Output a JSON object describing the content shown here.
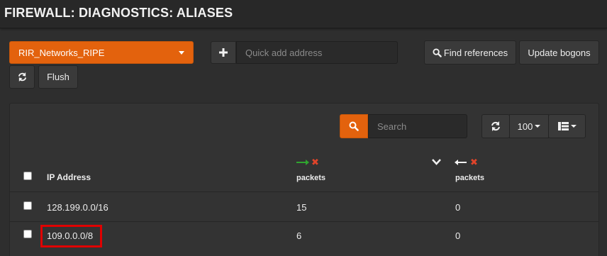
{
  "header": {
    "title": "FIREWALL: DIAGNOSTICS: ALIASES"
  },
  "toolbar": {
    "alias_selected": "RIR_Networks_RIPE",
    "quick_add_placeholder": "Quick add address",
    "find_references_label": "Find references",
    "update_bogons_label": "Update bogons",
    "flush_label": "Flush"
  },
  "grid": {
    "search_placeholder": "Search",
    "page_size": "100",
    "columns": {
      "ip_address": "IP Address",
      "in_packets": "packets",
      "out_packets": "packets"
    },
    "rows": [
      {
        "ip": "128.199.0.0/16",
        "in_packets": "15",
        "out_packets": "0"
      },
      {
        "ip": "109.0.0.0/8",
        "in_packets": "6",
        "out_packets": "0"
      }
    ]
  },
  "colors": {
    "accent": "#e3620d",
    "highlight": "#e00000",
    "pass_arrow": "#2fa52f",
    "block_x": "#e0442a"
  },
  "icons": [
    "plus-icon",
    "search-icon",
    "refresh-icon",
    "caret-down-icon",
    "columns-icon",
    "arrow-right-icon",
    "arrow-left-icon",
    "block-x-icon",
    "chevron-down-icon"
  ]
}
